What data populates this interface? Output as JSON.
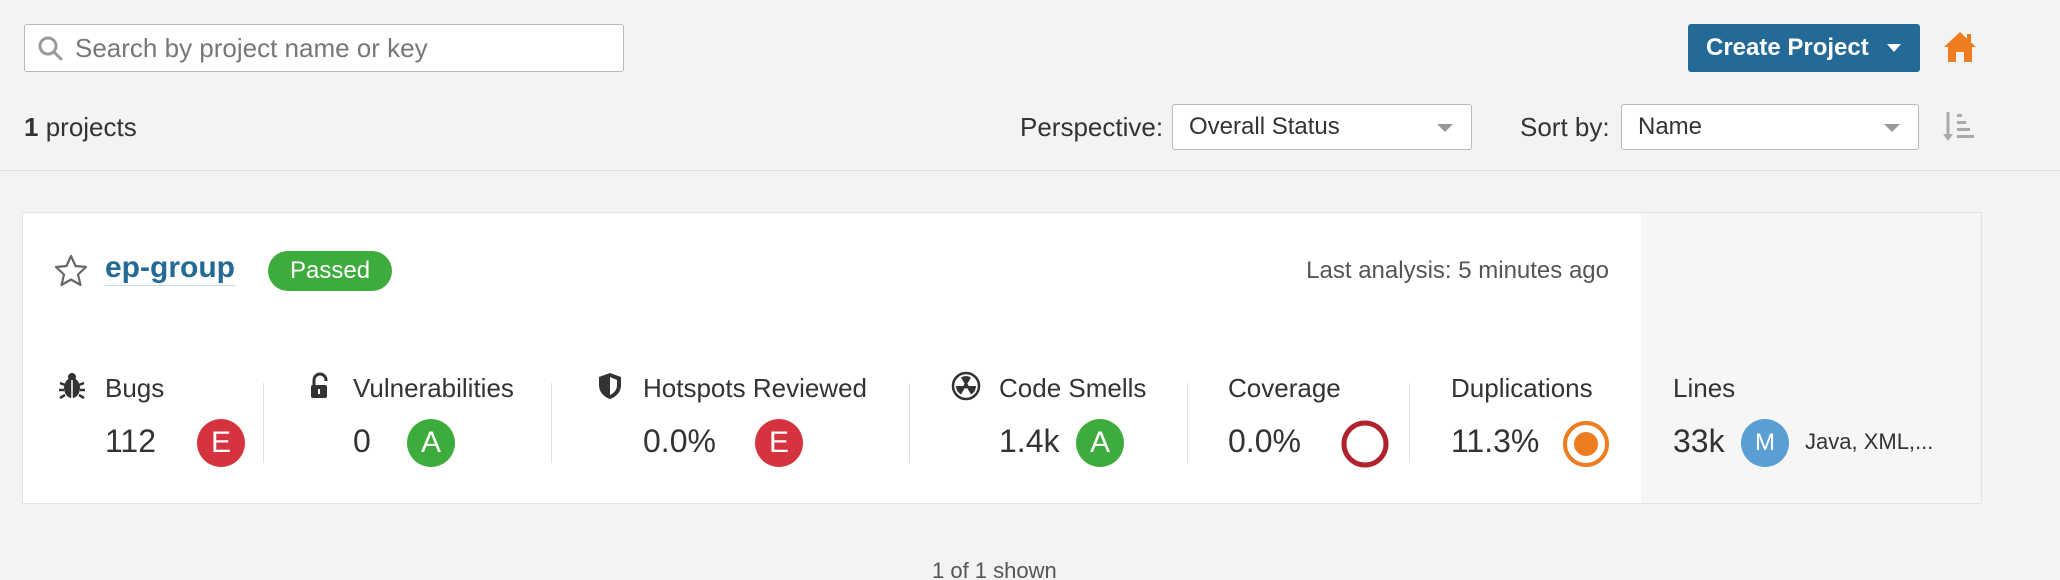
{
  "search": {
    "placeholder": "Search by project name or key"
  },
  "create_button": {
    "label": "Create Project"
  },
  "header": {
    "count_number": "1",
    "count_label": "projects",
    "perspective_label": "Perspective:",
    "perspective_value": "Overall Status",
    "sort_label": "Sort by:",
    "sort_value": "Name"
  },
  "project": {
    "name": "ep-group",
    "status": "Passed",
    "last_analysis": "Last analysis: 5 minutes ago",
    "metrics": {
      "bugs": {
        "title": "Bugs",
        "value": "112",
        "rating": "E"
      },
      "vulnerabilities": {
        "title": "Vulnerabilities",
        "value": "0",
        "rating": "A"
      },
      "hotspots": {
        "title": "Hotspots Reviewed",
        "value": "0.0%",
        "rating": "E"
      },
      "code_smells": {
        "title": "Code Smells",
        "value": "1.4k",
        "rating": "A"
      },
      "coverage": {
        "title": "Coverage",
        "value": "0.0%"
      },
      "duplications": {
        "title": "Duplications",
        "value": "11.3%"
      },
      "lines": {
        "title": "Lines",
        "value": "33k",
        "size": "M",
        "languages": "Java, XML,..."
      }
    }
  },
  "footer": {
    "shown": "1 of 1 shown"
  },
  "colors": {
    "primary": "#236a97",
    "passed": "#3dac3d",
    "rating_a": "#3dac3d",
    "rating_e": "#d4333f",
    "size_m": "#5a9fd4",
    "home": "#ed7d20",
    "coverage_ring": "#b0232c",
    "duplication_ring": "#ed7d20"
  }
}
